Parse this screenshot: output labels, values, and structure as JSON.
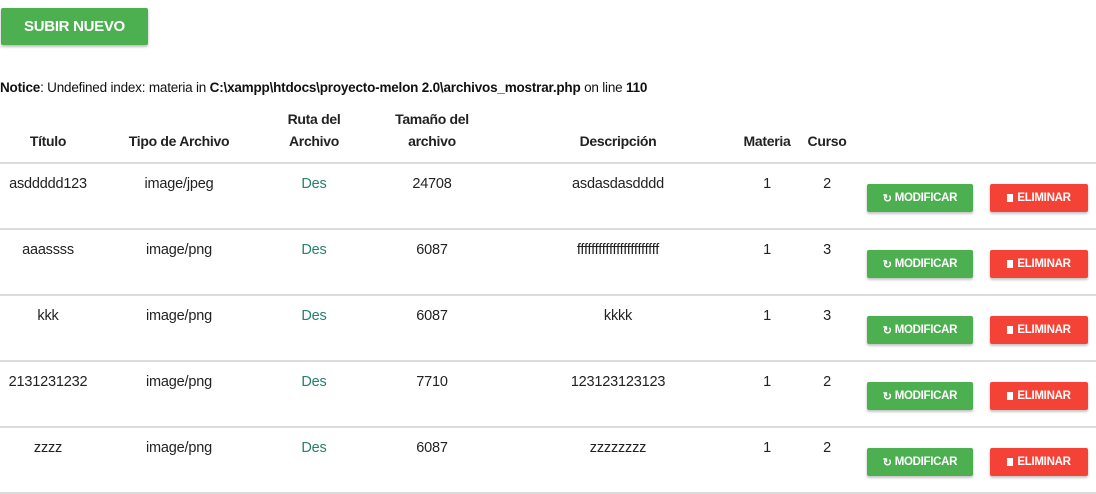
{
  "toolbar": {
    "upload_label": "SUBIR NUEVO"
  },
  "notice": {
    "label": "Notice",
    "message": ": Undefined index: materia in ",
    "path": "C:\\xampp\\htdocs\\proyecto-melon 2.0\\archivos_mostrar.php",
    "on_line": " on line ",
    "line": "110"
  },
  "table": {
    "headers": {
      "titulo": "Título",
      "tipo": "Tipo de Archivo",
      "ruta_1": "Ruta del",
      "ruta_2": "Archivo",
      "tamano_1": "Tamaño del",
      "tamano_2": "archivo",
      "descripcion": "Descripción",
      "materia": "Materia",
      "curso": "Curso"
    },
    "modify_label": "MODIFICAR",
    "delete_label": "ELIMINAR",
    "rows": [
      {
        "titulo": "asddddd123",
        "tipo": "image/jpeg",
        "ruta": "Des",
        "tamano": "24708",
        "descripcion": "asdasdasdddd",
        "materia": "1",
        "curso": "2"
      },
      {
        "titulo": "aaassss",
        "tipo": "image/png",
        "ruta": "Des",
        "tamano": "6087",
        "descripcion": "fffffffffffffffffffffff",
        "materia": "1",
        "curso": "3"
      },
      {
        "titulo": "kkk",
        "tipo": "image/png",
        "ruta": "Des",
        "tamano": "6087",
        "descripcion": "kkkk",
        "materia": "1",
        "curso": "3"
      },
      {
        "titulo": "2131231232",
        "tipo": "image/png",
        "ruta": "Des",
        "tamano": "7710",
        "descripcion": "123123123123",
        "materia": "1",
        "curso": "2"
      },
      {
        "titulo": "zzzz",
        "tipo": "image/png",
        "ruta": "Des",
        "tamano": "6087",
        "descripcion": "zzzzzzzz",
        "materia": "1",
        "curso": "2"
      }
    ]
  },
  "icons": {
    "modify": "refresh-icon",
    "delete": "trash-icon"
  },
  "colors": {
    "primary_green": "#4caf50",
    "danger_red": "#f44336",
    "link_teal": "#26806f"
  }
}
